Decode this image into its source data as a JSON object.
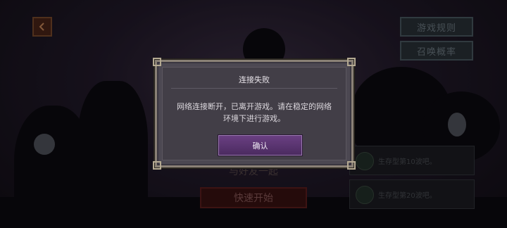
{
  "top_buttons": {
    "rules": "游戏规则",
    "probability": "召唤概率"
  },
  "menu": {
    "play_with_friends": "与好友一起",
    "quick_start": "快速开始"
  },
  "survival": [
    {
      "text": "生存型第10波吧。",
      "icon": "shield-icon"
    },
    {
      "text": "生存型第20波吧。",
      "icon": "shield-icon"
    }
  ],
  "dialog": {
    "title": "连接失败",
    "message": "网络连接断开，已离开游戏。请在稳定的网络环境下进行游戏。",
    "confirm_label": "确认"
  },
  "colors": {
    "confirm_button": "#5d3674",
    "dialog_bg": "#4c4852",
    "dialog_border": "#8a8176"
  }
}
